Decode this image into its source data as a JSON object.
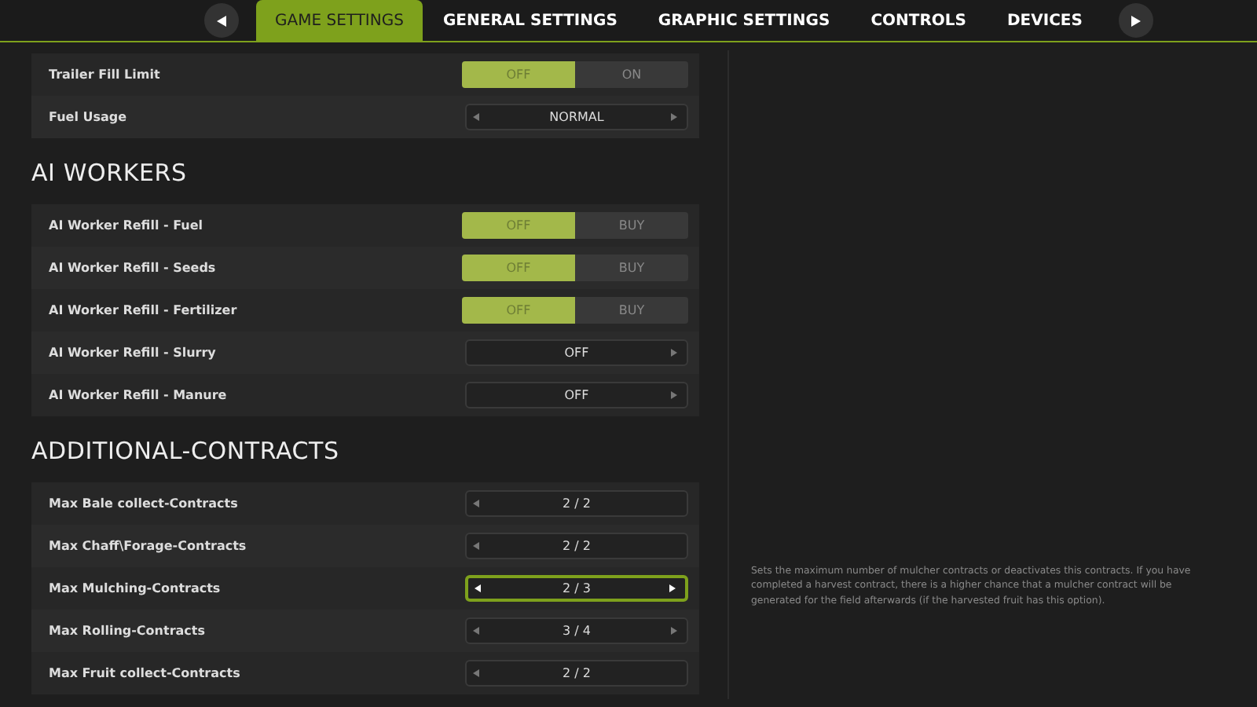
{
  "tabs": [
    {
      "label": "GAME SETTINGS",
      "selected": true
    },
    {
      "label": "GENERAL SETTINGS",
      "selected": false
    },
    {
      "label": "GRAPHIC SETTINGS",
      "selected": false
    },
    {
      "label": "CONTROLS",
      "selected": false
    },
    {
      "label": "DEVICES",
      "selected": false
    }
  ],
  "sections": [
    {
      "rows": [
        {
          "label": "Trailer Fill Limit",
          "kind": "toggle",
          "options": [
            {
              "label": "OFF",
              "selected": true
            },
            {
              "label": "ON",
              "selected": false
            }
          ]
        },
        {
          "label": "Fuel Usage",
          "kind": "selector",
          "value": "NORMAL",
          "has_prev": true,
          "has_next": true,
          "focused": false
        }
      ]
    },
    {
      "title": "AI WORKERS",
      "rows": [
        {
          "label": "AI Worker Refill - Fuel",
          "kind": "toggle",
          "options": [
            {
              "label": "OFF",
              "selected": true
            },
            {
              "label": "BUY",
              "selected": false
            }
          ]
        },
        {
          "label": "AI Worker Refill - Seeds",
          "kind": "toggle",
          "options": [
            {
              "label": "OFF",
              "selected": true
            },
            {
              "label": "BUY",
              "selected": false
            }
          ]
        },
        {
          "label": "AI Worker Refill - Fertilizer",
          "kind": "toggle",
          "options": [
            {
              "label": "OFF",
              "selected": true
            },
            {
              "label": "BUY",
              "selected": false
            }
          ]
        },
        {
          "label": "AI Worker Refill - Slurry",
          "kind": "selector",
          "value": "OFF",
          "has_prev": false,
          "has_next": true,
          "focused": false
        },
        {
          "label": "AI Worker Refill - Manure",
          "kind": "selector",
          "value": "OFF",
          "has_prev": false,
          "has_next": true,
          "focused": false
        }
      ]
    },
    {
      "title": "ADDITIONAL-CONTRACTS",
      "rows": [
        {
          "label": "Max Bale collect-Contracts",
          "kind": "selector",
          "value": "2 / 2",
          "has_prev": true,
          "has_next": false,
          "focused": false
        },
        {
          "label": "Max Chaff\\Forage-Contracts",
          "kind": "selector",
          "value": "2 / 2",
          "has_prev": true,
          "has_next": false,
          "focused": false
        },
        {
          "label": "Max Mulching-Contracts",
          "kind": "selector",
          "value": "2 / 3",
          "has_prev": true,
          "has_next": true,
          "focused": true
        },
        {
          "label": "Max Rolling-Contracts",
          "kind": "selector",
          "value": "3 / 4",
          "has_prev": true,
          "has_next": true,
          "focused": false
        },
        {
          "label": "Max Fruit collect-Contracts",
          "kind": "selector",
          "value": "2 / 2",
          "has_prev": true,
          "has_next": false,
          "focused": false
        }
      ]
    }
  ],
  "description": "Sets the maximum number of mulcher contracts or deactivates this contracts. If you have completed a harvest contract, there is a higher chance that a mulcher contract will be generated for the field afterwards (if the harvested fruit has this option)."
}
